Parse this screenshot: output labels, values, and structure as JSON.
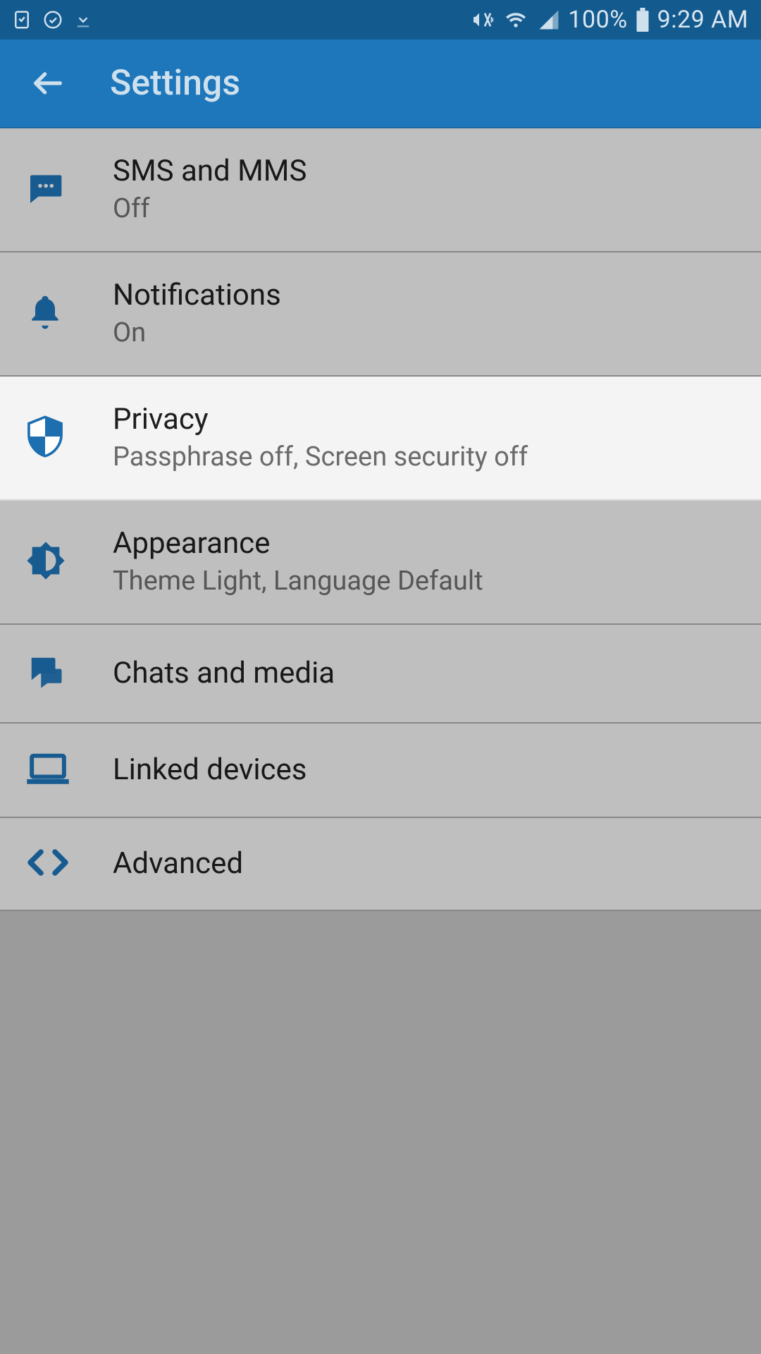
{
  "status": {
    "battery_pct": "100%",
    "time": "9:29 AM"
  },
  "app_bar": {
    "title": "Settings"
  },
  "colors": {
    "accent": "#1f77bb",
    "icon": "#1e6fb0"
  },
  "items": [
    {
      "icon": "message-icon",
      "label": "SMS and MMS",
      "sub": "Off"
    },
    {
      "icon": "bell-icon",
      "label": "Notifications",
      "sub": "On"
    },
    {
      "icon": "shield-icon",
      "label": "Privacy",
      "sub": "Passphrase off, Screen security off"
    },
    {
      "icon": "brightness-icon",
      "label": "Appearance",
      "sub": "Theme Light, Language Default"
    },
    {
      "icon": "chats-icon",
      "label": "Chats and media",
      "sub": ""
    },
    {
      "icon": "laptop-icon",
      "label": "Linked devices",
      "sub": ""
    },
    {
      "icon": "code-icon",
      "label": "Advanced",
      "sub": ""
    }
  ]
}
